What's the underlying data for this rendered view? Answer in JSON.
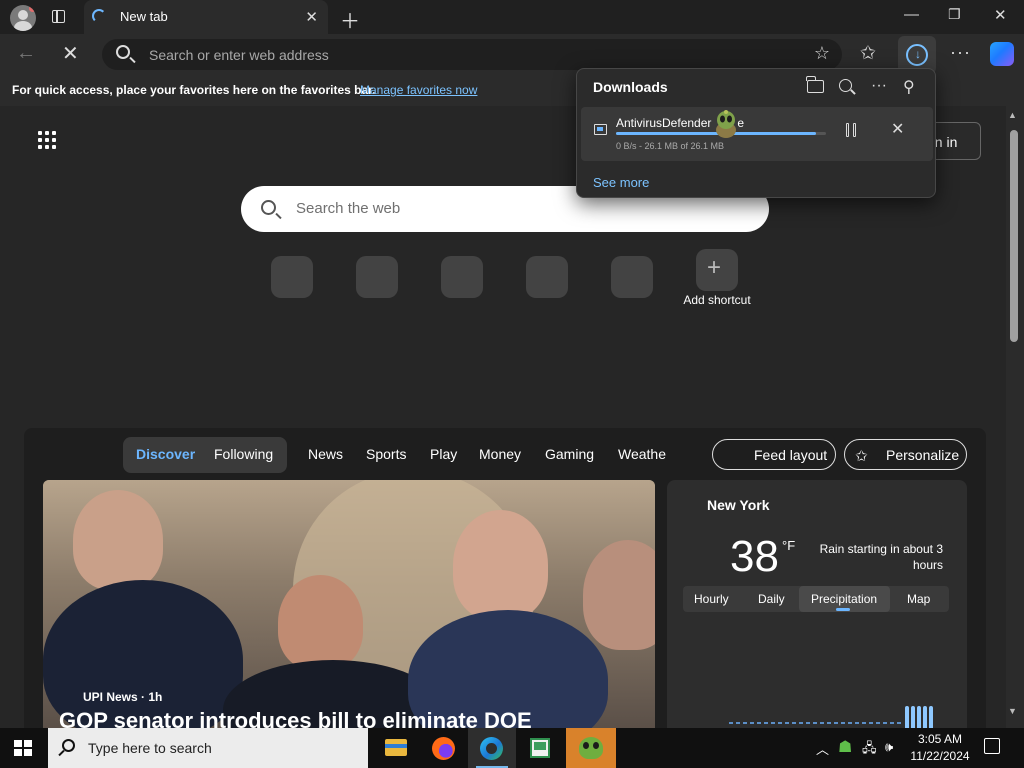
{
  "browser": {
    "tab_title": "New tab",
    "address_placeholder": "Search or enter web address",
    "favorites_bar": {
      "message": "For quick access, place your favorites here on the favorites bar.",
      "link": "Manage favorites now"
    },
    "accent": "#6cb6ff"
  },
  "downloads": {
    "title": "Downloads",
    "item": {
      "filename_start": "AntivirusDefender",
      "filename_end": "e",
      "status": "0 B/s - 26.1 MB of 26.1 MB",
      "progress": 0.95
    },
    "see_more": "See more"
  },
  "ntp": {
    "search_placeholder": "Search the web",
    "sign_in_partial": "gn in",
    "add_shortcut": "Add shortcut",
    "feed": {
      "pills": [
        "Discover",
        "Following"
      ],
      "nav": [
        "News",
        "Sports",
        "Play",
        "Money",
        "Gaming",
        "Weathe"
      ],
      "feed_layout": "Feed layout",
      "personalize": "Personalize",
      "hero": {
        "source": "UPI News · 1h",
        "headline": "GOP senator introduces bill to eliminate DOE"
      }
    },
    "weather": {
      "city": "New York",
      "temperature": "38",
      "unit": "°F",
      "condition": "Rain starting in about 3 hours",
      "tabs": [
        "Hourly",
        "Daily",
        "Precipitation",
        "Map"
      ],
      "selected_tab": "Precipitation"
    }
  },
  "taskbar": {
    "search_placeholder": "Type here to search",
    "time": "3:05 AM",
    "date": "11/22/2024"
  }
}
